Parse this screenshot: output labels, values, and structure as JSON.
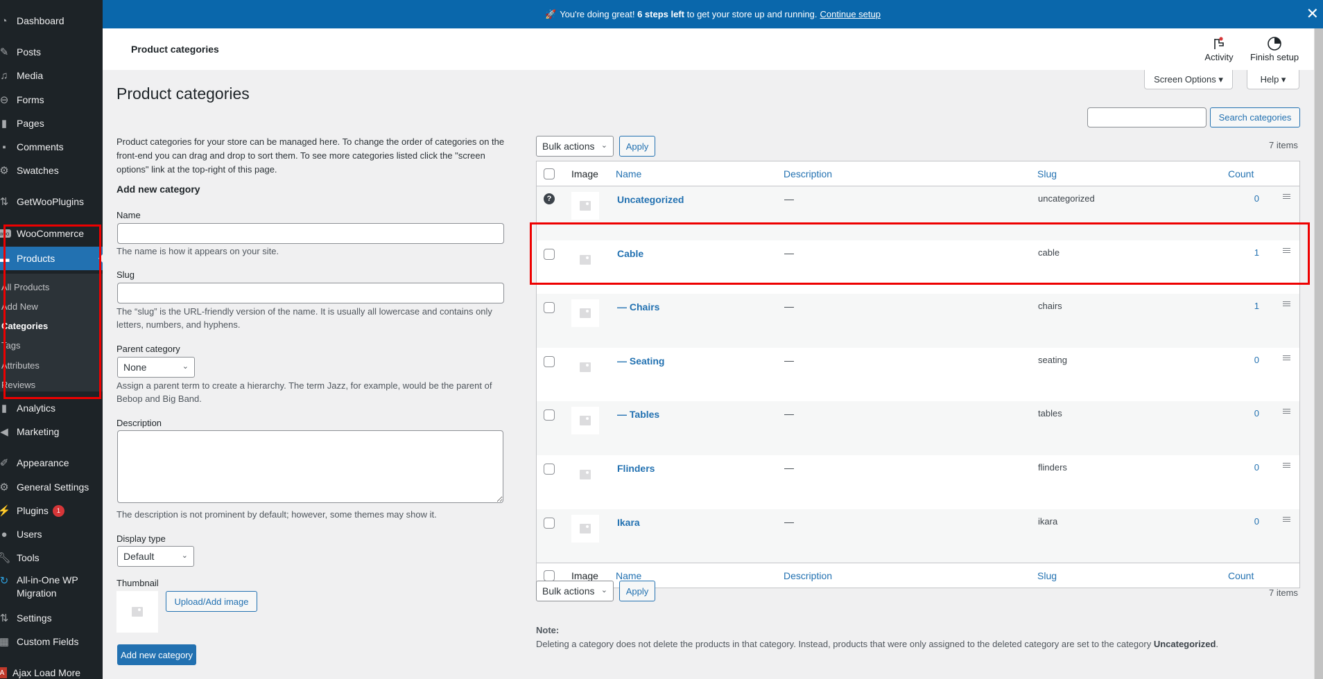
{
  "sidebar": {
    "items": [
      {
        "label": "Dashboard",
        "icon": "dashboard-icon"
      },
      {
        "label": "Posts",
        "icon": "pin-icon"
      },
      {
        "label": "Media",
        "icon": "media-icon"
      },
      {
        "label": "Forms",
        "icon": "forms-icon"
      },
      {
        "label": "Pages",
        "icon": "pages-icon"
      },
      {
        "label": "Comments",
        "icon": "comment-icon"
      },
      {
        "label": "Swatches",
        "icon": "gear-icon"
      },
      {
        "label": "GetWooPlugins",
        "icon": "sliders-icon"
      },
      {
        "label": "WooCommerce",
        "icon": "woo-icon"
      },
      {
        "label": "Products",
        "icon": "archive-icon"
      },
      {
        "label": "Analytics",
        "icon": "bar-chart-icon"
      },
      {
        "label": "Marketing",
        "icon": "megaphone-icon"
      },
      {
        "label": "Appearance",
        "icon": "brush-icon"
      },
      {
        "label": "General Settings",
        "icon": "gear-icon"
      },
      {
        "label": "Plugins",
        "icon": "plug-icon",
        "badge": "1"
      },
      {
        "label": "Users",
        "icon": "user-icon"
      },
      {
        "label": "Tools",
        "icon": "wrench-icon"
      },
      {
        "label": "All-in-One WP",
        "label2": "Migration",
        "icon": "migration-icon"
      },
      {
        "label": "Settings",
        "icon": "sliders-icon"
      },
      {
        "label": "Custom Fields",
        "icon": "table-icon"
      },
      {
        "label": "Ajax Load More",
        "icon": "alm-icon"
      }
    ],
    "submenu": [
      "All Products",
      "Add New",
      "Categories",
      "Tags",
      "Attributes",
      "Reviews"
    ],
    "submenu_current": "Categories"
  },
  "notice": {
    "emoji": "🚀",
    "text_before": "You're doing great!",
    "bold": "6 steps left",
    "text_after": "to get your store up and running.",
    "link": "Continue setup"
  },
  "header": {
    "title": "Product categories",
    "activity_label": "Activity",
    "finish_setup_label": "Finish setup",
    "screen_options_label": "Screen Options ▾",
    "help_label": "Help ▾"
  },
  "page": {
    "title": "Product categories",
    "intro": "Product categories for your store can be managed here. To change the order of categories on the front-end you can drag and drop to sort them. To see more categories listed click the \"screen options\" link at the top-right of this page.",
    "add_heading": "Add new category"
  },
  "form": {
    "name_label": "Name",
    "name_value": "",
    "name_help": "The name is how it appears on your site.",
    "slug_label": "Slug",
    "slug_value": "",
    "slug_help": "The “slug” is the URL-friendly version of the name. It is usually all lowercase and contains only letters, numbers, and hyphens.",
    "parent_label": "Parent category",
    "parent_value": "None",
    "parent_help": "Assign a parent term to create a hierarchy. The term Jazz, for example, would be the parent of Bebop and Big Band.",
    "description_label": "Description",
    "description_value": "",
    "description_help": "The description is not prominent by default; however, some themes may show it.",
    "display_type_label": "Display type",
    "display_type_value": "Default",
    "thumbnail_label": "Thumbnail",
    "upload_button": "Upload/Add image",
    "submit_button": "Add new category"
  },
  "list": {
    "search_value": "",
    "search_button": "Search categories",
    "bulk_actions": "Bulk actions",
    "apply": "Apply",
    "items_count": "7 items",
    "columns": {
      "image": "Image",
      "name": "Name",
      "description": "Description",
      "slug": "Slug",
      "count": "Count"
    },
    "rows": [
      {
        "name": "Uncategorized",
        "description": "—",
        "slug": "uncategorized",
        "count": "0",
        "default": true
      },
      {
        "name": "Cable",
        "description": "—",
        "slug": "cable",
        "count": "1"
      },
      {
        "name": "— Chairs",
        "description": "—",
        "slug": "chairs",
        "count": "1"
      },
      {
        "name": "— Seating",
        "description": "—",
        "slug": "seating",
        "count": "0"
      },
      {
        "name": "— Tables",
        "description": "—",
        "slug": "tables",
        "count": "0"
      },
      {
        "name": "Flinders",
        "description": "—",
        "slug": "flinders",
        "count": "0"
      },
      {
        "name": "Ikara",
        "description": "—",
        "slug": "ikara",
        "count": "0"
      }
    ]
  },
  "note": {
    "heading": "Note:",
    "text": "Deleting a category does not delete the products in that category. Instead, products that were only assigned to the deleted category are set to the category",
    "bold": "Uncategorized",
    "end": "."
  },
  "colors": {
    "accent": "#2271b1",
    "notice": "#0a67ab",
    "sidebar": "#1d2327",
    "highlight": "#e00000"
  }
}
